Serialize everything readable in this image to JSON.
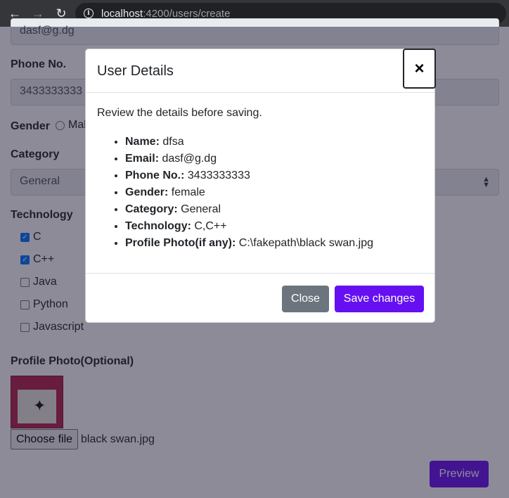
{
  "browser": {
    "url_host": "localhost",
    "url_rest": ":4200/users/create"
  },
  "form": {
    "email_value": "dasf@g.dg",
    "phone_label": "Phone No.",
    "phone_value": "3433333333",
    "gender_label": "Gender",
    "gender_option_male": "Male",
    "category_label": "Category",
    "category_value": "General",
    "technology_label": "Technology",
    "technologies": [
      {
        "label": "C",
        "checked": true
      },
      {
        "label": "C++",
        "checked": true
      },
      {
        "label": "Java",
        "checked": false
      },
      {
        "label": "Python",
        "checked": false
      },
      {
        "label": "Javascript",
        "checked": false
      }
    ],
    "photo_label": "Profile Photo(Optional)",
    "choose_file_label": "Choose file",
    "file_name": "black swan.jpg",
    "preview_label": "Preview"
  },
  "modal": {
    "title": "User Details",
    "close_symbol": "×",
    "intro": "Review the details before saving.",
    "details": [
      {
        "key": "Name:",
        "value": "dfsa"
      },
      {
        "key": "Email:",
        "value": "dasf@g.dg"
      },
      {
        "key": "Phone No.:",
        "value": "3433333333"
      },
      {
        "key": "Gender:",
        "value": "female"
      },
      {
        "key": "Category:",
        "value": "General"
      },
      {
        "key": "Technology:",
        "value": "C,C++"
      },
      {
        "key": "Profile Photo(if any):",
        "value": "C:\\fakepath\\black swan.jpg"
      }
    ],
    "close_button": "Close",
    "save_button": "Save changes"
  }
}
